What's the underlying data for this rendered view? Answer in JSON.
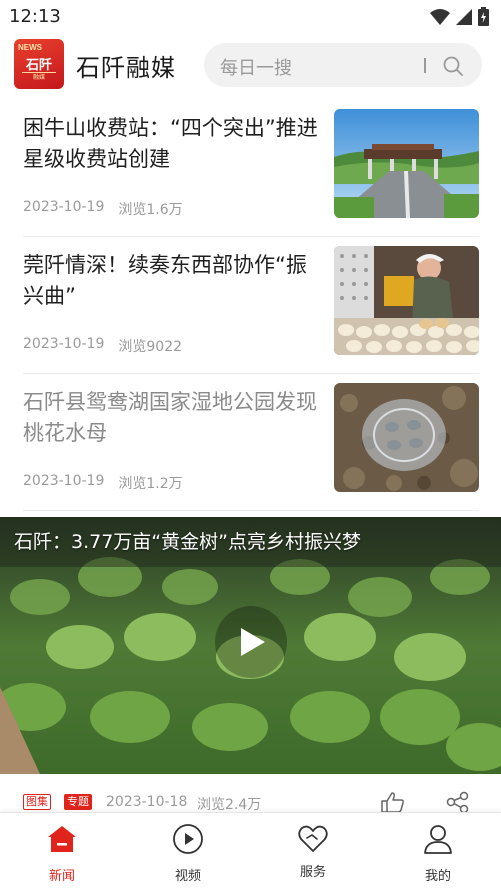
{
  "status_bar": {
    "time": "12:13"
  },
  "header": {
    "logo": {
      "top_text": "NEWS",
      "main_text": "石阡",
      "sub_text": "融媒"
    },
    "app_title": "石阡融媒",
    "search": {
      "placeholder": "每日一搜"
    }
  },
  "news": [
    {
      "title": "困牛山收费站：“四个突出”推进星级收费站创建",
      "date": "2023-10-19",
      "views": "浏览1.6万",
      "read": false
    },
    {
      "title": "莞阡情深！续奏东西部协作“振兴曲”",
      "date": "2023-10-19",
      "views": "浏览9022",
      "read": false
    },
    {
      "title": "石阡县鸳鸯湖国家湿地公园发现桃花水母",
      "date": "2023-10-19",
      "views": "浏览1.2万",
      "read": true
    }
  ],
  "video_card": {
    "title": "石阡：3.77万亩“黄金树”点亮乡村振兴梦",
    "tags": [
      "图集",
      "专题"
    ],
    "date": "2023-10-18",
    "views": "浏览2.4万"
  },
  "tab_bar": [
    {
      "label": "新闻",
      "icon": "home-icon",
      "active": true
    },
    {
      "label": "视频",
      "icon": "play-circle-icon",
      "active": false
    },
    {
      "label": "服务",
      "icon": "heart-icon",
      "active": false
    },
    {
      "label": "我的",
      "icon": "person-icon",
      "active": false
    }
  ],
  "colors": {
    "accent": "#e0241b",
    "text_primary": "#1f1f1f",
    "text_secondary": "#9a9a9a"
  }
}
